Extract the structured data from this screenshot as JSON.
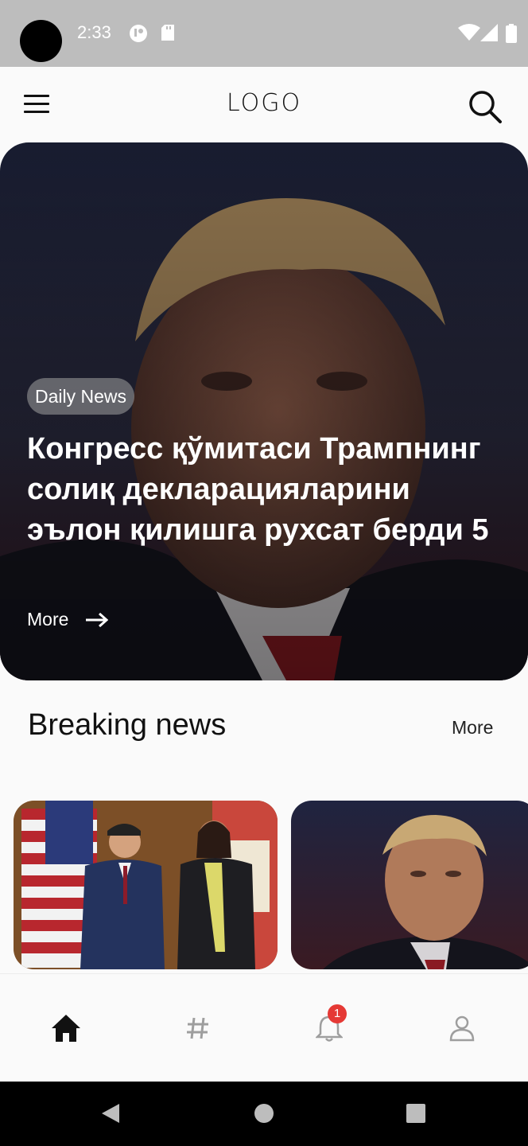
{
  "status_bar": {
    "time": "2:33",
    "icons": [
      "notification-icon",
      "sd-card-icon",
      "wifi-icon",
      "signal-icon",
      "battery-icon"
    ]
  },
  "header": {
    "logo": "LOGO",
    "menu_icon": "hamburger-menu-icon",
    "search_icon": "search-icon"
  },
  "hero": {
    "tag": "Daily News",
    "title": "Конгресс қўмитаси Трампнинг солиқ декларацияларини эълон қилишга рухсат берди 5",
    "more_label": "More",
    "more_icon": "arrow-right-icon"
  },
  "breaking": {
    "title": "Breaking news",
    "more_label": "More",
    "cards": [
      {
        "image": "officials-with-flags-photo"
      },
      {
        "image": "man-portrait-photo"
      }
    ]
  },
  "bottom_nav": {
    "items": [
      {
        "icon": "home-icon",
        "active": true
      },
      {
        "icon": "hashtag-icon",
        "active": false
      },
      {
        "icon": "bell-icon",
        "active": false,
        "badge": "1"
      },
      {
        "icon": "profile-icon",
        "active": false
      }
    ]
  },
  "system_nav": {
    "items": [
      "back-icon",
      "home-circle-icon",
      "recents-icon"
    ]
  },
  "colors": {
    "accent": "#e53935",
    "status_bar": "#bdbdbd",
    "background": "#fafafa"
  }
}
